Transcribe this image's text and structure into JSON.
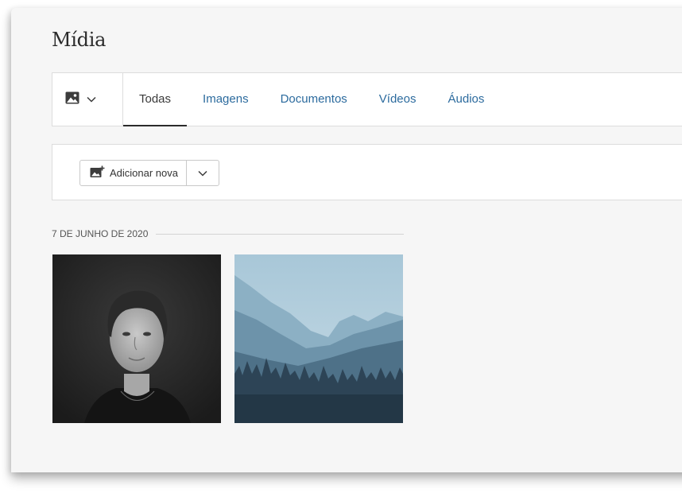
{
  "page": {
    "title": "Mídia"
  },
  "filter_bar": {
    "type_icon": "image-icon",
    "tabs": [
      {
        "label": "Todas",
        "active": true
      },
      {
        "label": "Imagens",
        "active": false
      },
      {
        "label": "Documentos",
        "active": false
      },
      {
        "label": "Vídeos",
        "active": false
      },
      {
        "label": "Áudios",
        "active": false
      }
    ]
  },
  "actions": {
    "add_new_label": "Adicionar nova",
    "add_new_icon": "add-image-icon"
  },
  "media_groups": [
    {
      "date": "7 DE JUNHO DE 2020",
      "items": [
        {
          "kind": "portrait-photo",
          "icon": "portrait-thumbnail"
        },
        {
          "kind": "landscape-photo",
          "icon": "mountain-forest-thumbnail"
        }
      ]
    }
  ],
  "colors": {
    "background": "#f6f6f6",
    "panel": "#ffffff",
    "link": "#2c6b9e",
    "text": "#2b2b2b",
    "border": "#dcdcdc"
  }
}
